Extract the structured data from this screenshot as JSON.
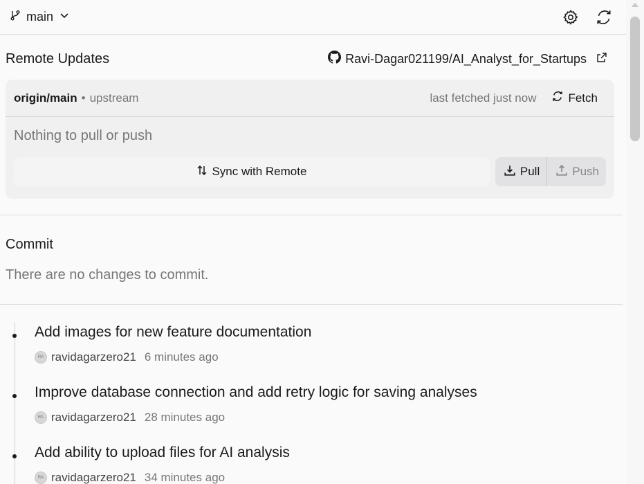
{
  "topbar": {
    "branch": "main",
    "branch_icon": "git-branch-icon",
    "settings_icon": "gear-icon",
    "refresh_icon": "refresh-icon"
  },
  "remote": {
    "title": "Remote Updates",
    "repo": "Ravi-Dagar021199/AI_Analyst_for_Startups",
    "origin": "origin/main",
    "separator": "•",
    "upstream": "upstream",
    "fetched": "last fetched just now",
    "fetch_label": "Fetch",
    "status": "Nothing to pull or push",
    "sync_label": "Sync with Remote",
    "pull_label": "Pull",
    "push_label": "Push"
  },
  "commit": {
    "title": "Commit",
    "message": "There are no changes to commit."
  },
  "history": [
    {
      "title": "Add images for new feature documentation",
      "avatar": "RA",
      "author": "ravidagarzero21",
      "time": "6 minutes ago"
    },
    {
      "title": "Improve database connection and add retry logic for saving analyses",
      "avatar": "RA",
      "author": "ravidagarzero21",
      "time": "28 minutes ago"
    },
    {
      "title": "Add ability to upload files for AI analysis",
      "avatar": "RA",
      "author": "ravidagarzero21",
      "time": "34 minutes ago"
    }
  ]
}
